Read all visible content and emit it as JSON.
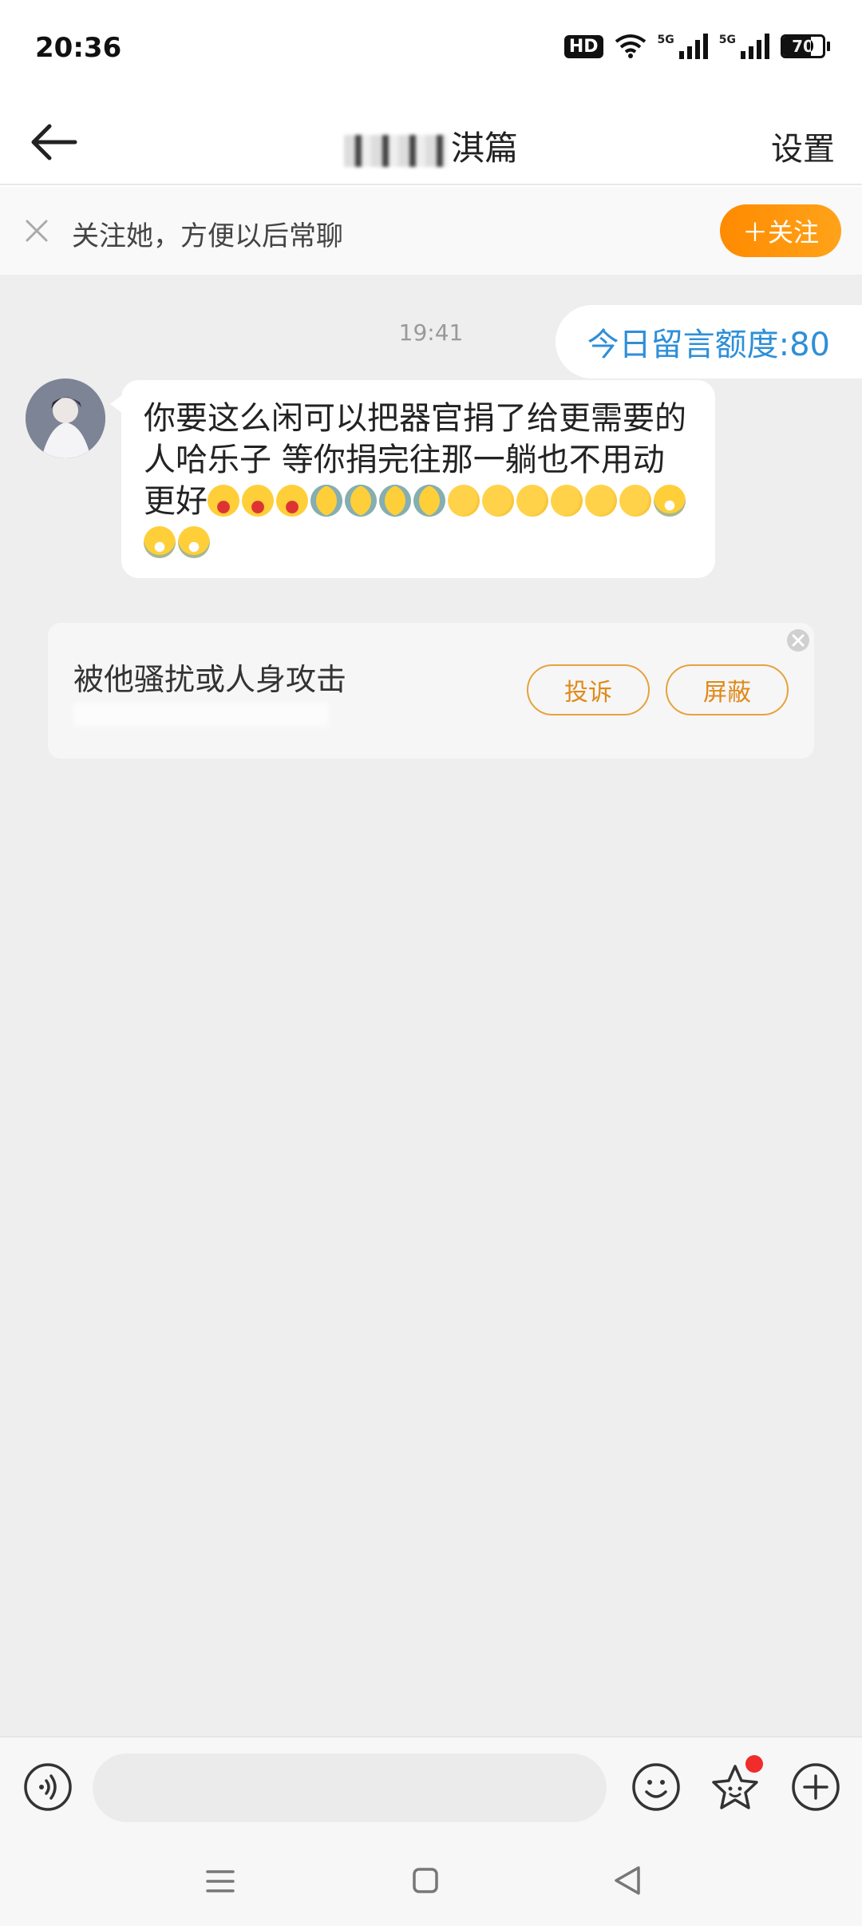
{
  "status_bar": {
    "time": "20:36",
    "hd_label": "HD",
    "network_a": "5G",
    "network_b": "5G",
    "battery_level": "70",
    "battery_fraction": 0.7
  },
  "header": {
    "title_visible_text": "淇篇",
    "settings_label": "设置",
    "back_icon": "arrow-left-icon"
  },
  "follow_banner": {
    "text": "关注她，方便以后常聊",
    "follow_button_label": "＋关注",
    "accent_color": "#ff8a00"
  },
  "chat": {
    "timestamp": "19:41",
    "quota_text": "今日留言额度:80",
    "messages": [
      {
        "sender": "other",
        "text": "你要这么闲可以把器官捐了给更需要的人哈乐子 等你捐完往那一躺也不用动更好",
        "emojis": [
          "scream",
          "scream",
          "scream",
          "cry",
          "cry",
          "cry",
          "cry",
          "roll",
          "roll",
          "roll",
          "roll",
          "roll",
          "roll",
          "joy",
          "joy",
          "joy"
        ]
      }
    ]
  },
  "report_card": {
    "text": "被他骚扰或人身攻击",
    "complain_label": "投诉",
    "block_label": "屏蔽",
    "accent_color": "#e6a23c"
  },
  "input_bar": {
    "placeholder": "",
    "voice_icon": "voice-icon",
    "emoji_icon": "emoji-icon",
    "sticker_icon": "sticker-icon",
    "plus_icon": "plus-icon"
  },
  "nav_bar": {
    "menu_icon": "menu-icon",
    "home_icon": "home-icon",
    "back_icon": "back-triangle-icon"
  }
}
